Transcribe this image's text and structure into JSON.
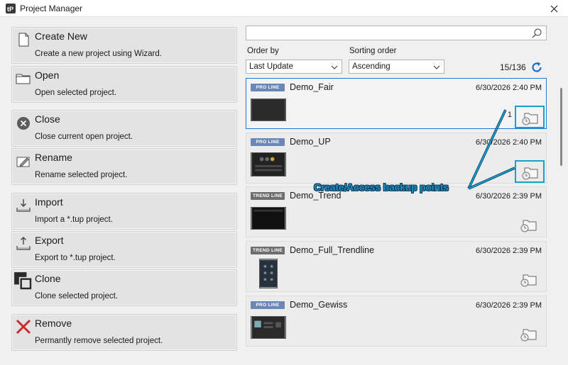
{
  "window": {
    "title": "Project Manager",
    "close_icon": "close-icon"
  },
  "actions": [
    {
      "label": "Create New",
      "description": "Create a new project using Wizard.",
      "icon": "new-document-icon"
    },
    {
      "label": "Open",
      "description": "Open selected project.",
      "icon": "folder-icon"
    },
    {
      "label": "Close",
      "description": "Close current open project.",
      "icon": "close-circle-icon"
    },
    {
      "label": "Rename",
      "description": "Rename selected project.",
      "icon": "pencil-icon"
    },
    {
      "label": "Import",
      "description": "Import a *.tup project.",
      "icon": "import-icon"
    },
    {
      "label": "Export",
      "description": "Export to *.tup project.",
      "icon": "export-icon"
    },
    {
      "label": "Clone",
      "description": "Clone selected project.",
      "icon": "clone-icon"
    },
    {
      "label": "Remove",
      "description": "Permantly remove selected project.",
      "icon": "remove-x-icon"
    }
  ],
  "search": {
    "value": "",
    "placeholder": ""
  },
  "filters": {
    "order_by_label": "Order by",
    "order_by_value": "Last Update",
    "sorting_label": "Sorting order",
    "sorting_value": "Ascending"
  },
  "count": "15/136",
  "projects": [
    {
      "badge": "PRO LINE",
      "name": "Demo_Fair",
      "date": "6/30/2026 2:40 PM",
      "backups": "1",
      "selected": true
    },
    {
      "badge": "PRO LINE",
      "name": "Demo_UP",
      "date": "6/30/2026 2:40 PM",
      "backups": "",
      "selected": false
    },
    {
      "badge": "TREND LINE",
      "name": "Demo_Trend",
      "date": "6/30/2026 2:39 PM",
      "backups": "",
      "selected": false
    },
    {
      "badge": "TREND LINE",
      "name": "Demo_Full_Trendline",
      "date": "6/30/2026 2:39 PM",
      "backups": "",
      "selected": false
    },
    {
      "badge": "PRO LINE",
      "name": "Demo_Gewiss",
      "date": "6/30/2026 2:39 PM",
      "backups": "",
      "selected": false
    }
  ],
  "annotation": {
    "text": "Create/Access backup points"
  },
  "colors": {
    "accent": "#1e7ad8",
    "annotation": "#1b8fc4",
    "pro_badge": "#6b87b5",
    "trend_badge": "#6e6e6e"
  }
}
